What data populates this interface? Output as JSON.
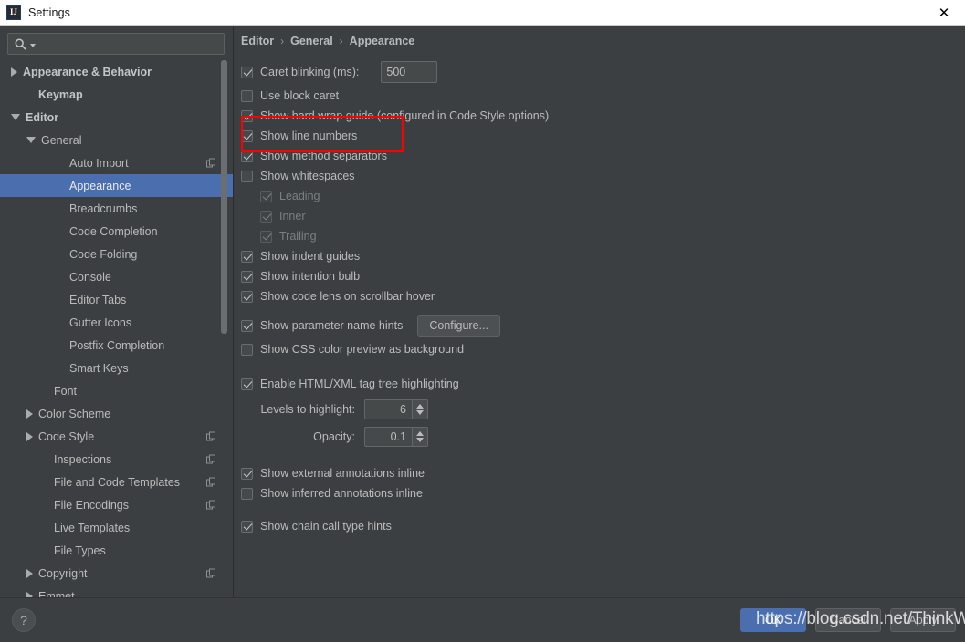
{
  "window": {
    "title": "Settings",
    "icon": "intellij-idea-logo-icon",
    "close_label": "✕"
  },
  "search": {
    "placeholder": "",
    "value": "",
    "icon": "search-icon"
  },
  "sidebar": {
    "items": [
      {
        "label": "Appearance & Behavior",
        "depth": 0,
        "arrow": "closed",
        "bold": true,
        "selected": false,
        "badge": false
      },
      {
        "label": "Keymap",
        "depth": 1,
        "arrow": "none",
        "bold": true,
        "selected": false,
        "badge": false
      },
      {
        "label": "Editor",
        "depth": 0,
        "arrow": "open",
        "bold": true,
        "selected": false,
        "badge": false
      },
      {
        "label": "General",
        "depth": 1,
        "arrow": "open",
        "bold": false,
        "selected": false,
        "badge": false
      },
      {
        "label": "Auto Import",
        "depth": 3,
        "arrow": "none",
        "bold": false,
        "selected": false,
        "badge": true
      },
      {
        "label": "Appearance",
        "depth": 3,
        "arrow": "none",
        "bold": false,
        "selected": true,
        "badge": false
      },
      {
        "label": "Breadcrumbs",
        "depth": 3,
        "arrow": "none",
        "bold": false,
        "selected": false,
        "badge": false
      },
      {
        "label": "Code Completion",
        "depth": 3,
        "arrow": "none",
        "bold": false,
        "selected": false,
        "badge": false
      },
      {
        "label": "Code Folding",
        "depth": 3,
        "arrow": "none",
        "bold": false,
        "selected": false,
        "badge": false
      },
      {
        "label": "Console",
        "depth": 3,
        "arrow": "none",
        "bold": false,
        "selected": false,
        "badge": false
      },
      {
        "label": "Editor Tabs",
        "depth": 3,
        "arrow": "none",
        "bold": false,
        "selected": false,
        "badge": false
      },
      {
        "label": "Gutter Icons",
        "depth": 3,
        "arrow": "none",
        "bold": false,
        "selected": false,
        "badge": false
      },
      {
        "label": "Postfix Completion",
        "depth": 3,
        "arrow": "none",
        "bold": false,
        "selected": false,
        "badge": false
      },
      {
        "label": "Smart Keys",
        "depth": 3,
        "arrow": "none",
        "bold": false,
        "selected": false,
        "badge": false
      },
      {
        "label": "Font",
        "depth": 2,
        "arrow": "none",
        "bold": false,
        "selected": false,
        "badge": false
      },
      {
        "label": "Color Scheme",
        "depth": 1,
        "arrow": "closed",
        "bold": false,
        "selected": false,
        "badge": false
      },
      {
        "label": "Code Style",
        "depth": 1,
        "arrow": "closed",
        "bold": false,
        "selected": false,
        "badge": true
      },
      {
        "label": "Inspections",
        "depth": 2,
        "arrow": "none",
        "bold": false,
        "selected": false,
        "badge": true
      },
      {
        "label": "File and Code Templates",
        "depth": 2,
        "arrow": "none",
        "bold": false,
        "selected": false,
        "badge": true
      },
      {
        "label": "File Encodings",
        "depth": 2,
        "arrow": "none",
        "bold": false,
        "selected": false,
        "badge": true
      },
      {
        "label": "Live Templates",
        "depth": 2,
        "arrow": "none",
        "bold": false,
        "selected": false,
        "badge": false
      },
      {
        "label": "File Types",
        "depth": 2,
        "arrow": "none",
        "bold": false,
        "selected": false,
        "badge": false
      },
      {
        "label": "Copyright",
        "depth": 1,
        "arrow": "closed",
        "bold": false,
        "selected": false,
        "badge": true
      },
      {
        "label": "Emmet",
        "depth": 1,
        "arrow": "closed",
        "bold": false,
        "selected": false,
        "badge": false
      }
    ],
    "scrollbar": {
      "thumb_top": 0,
      "thumb_height": 300
    }
  },
  "breadcrumb": {
    "items": [
      "Editor",
      "General",
      "Appearance"
    ],
    "separator": "›"
  },
  "settings": {
    "caret_blinking": {
      "label": "Caret blinking (ms):",
      "checked": true,
      "value": "500"
    },
    "use_block_caret": {
      "label": "Use block caret",
      "checked": false
    },
    "show_hard_wrap_guide": {
      "label": "Show hard wrap guide (configured in Code Style options)",
      "checked": true
    },
    "show_line_numbers": {
      "label": "Show line numbers",
      "checked": true
    },
    "show_method_separators": {
      "label": "Show method separators",
      "checked": true
    },
    "show_whitespaces": {
      "label": "Show whitespaces",
      "checked": false
    },
    "whitespace_leading": {
      "label": "Leading",
      "checked": true,
      "disabled": true
    },
    "whitespace_inner": {
      "label": "Inner",
      "checked": true,
      "disabled": true
    },
    "whitespace_trailing": {
      "label": "Trailing",
      "checked": true,
      "disabled": true
    },
    "show_indent_guides": {
      "label": "Show indent guides",
      "checked": true
    },
    "show_intention_bulb": {
      "label": "Show intention bulb",
      "checked": true
    },
    "show_code_lens": {
      "label": "Show code lens on scrollbar hover",
      "checked": true
    },
    "show_parameter_name_hints": {
      "label": "Show parameter name hints",
      "checked": true,
      "button": "Configure..."
    },
    "show_css_color_preview": {
      "label": "Show CSS color preview as background",
      "checked": false
    },
    "enable_tag_tree_highlighting": {
      "label": "Enable HTML/XML tag tree highlighting",
      "checked": true
    },
    "levels_to_highlight": {
      "label": "Levels to highlight:",
      "value": "6"
    },
    "opacity": {
      "label": "Opacity:",
      "value": "0.1"
    },
    "show_external_annotations": {
      "label": "Show external annotations inline",
      "checked": true
    },
    "show_inferred_annotations": {
      "label": "Show inferred annotations inline",
      "checked": false
    },
    "show_chain_call_type_hints": {
      "label": "Show chain call type hints",
      "checked": true
    }
  },
  "annotation": {
    "color": "#ff0000"
  },
  "footer": {
    "help_label": "?",
    "ok_label": "OK",
    "cancel_label": "Cancel",
    "apply_label": "Apply",
    "watermark": "https://blog.csdn.net/ThinkWon"
  },
  "colors": {
    "window_bg": "#3c3f41",
    "titlebar_bg": "#ffffff",
    "selection": "#4b6eaf",
    "text": "#bbbbbb",
    "accent_red": "#ff0000"
  }
}
